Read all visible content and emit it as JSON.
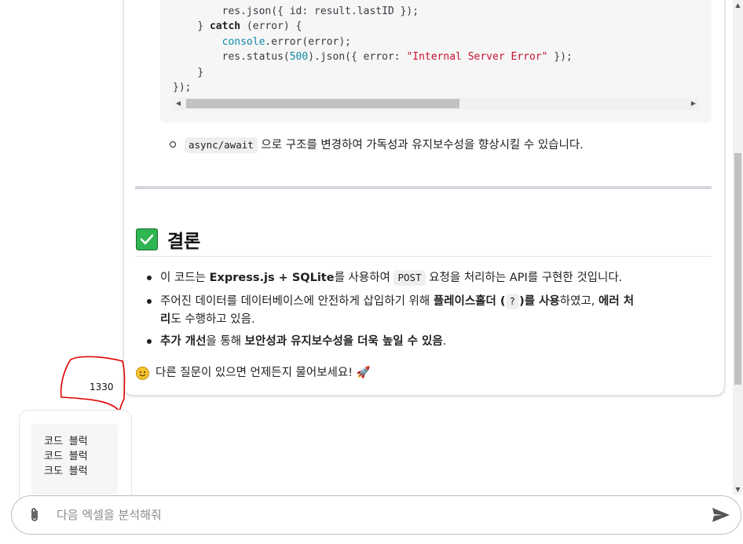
{
  "code": {
    "lines": [
      {
        "indent": "        ",
        "parts": [
          {
            "t": "res.json({ id: result.lastID });",
            "c": ""
          }
        ]
      },
      {
        "indent": "    ",
        "parts": [
          {
            "t": "} ",
            "c": ""
          },
          {
            "t": "catch",
            "c": "kw"
          },
          {
            "t": " (error) {",
            "c": ""
          }
        ]
      },
      {
        "indent": "        ",
        "parts": [
          {
            "t": "console",
            "c": "fn"
          },
          {
            "t": ".error(error);",
            "c": ""
          }
        ]
      },
      {
        "indent": "        ",
        "parts": [
          {
            "t": "res.status(",
            "c": ""
          },
          {
            "t": "500",
            "c": "num"
          },
          {
            "t": ").json({ error: ",
            "c": ""
          },
          {
            "t": "\"Internal Server Error\"",
            "c": "str"
          },
          {
            "t": " });",
            "c": ""
          }
        ]
      },
      {
        "indent": "    ",
        "parts": [
          {
            "t": "}",
            "c": ""
          }
        ]
      },
      {
        "indent": "",
        "parts": [
          {
            "t": "});",
            "c": ""
          }
        ]
      }
    ]
  },
  "subbullet": {
    "code": "async/await",
    "text": " 으로 구조를 변경하여 가독성과 유지보수성을 향상시킬 수 있습니다."
  },
  "conclusion": {
    "heading": "결론",
    "b1": {
      "p1": "이 코드는 ",
      "b1": "Express.js + SQLite",
      "p2": "를 사용하여 ",
      "code": "POST",
      "p3": " 요청을 처리하는 API를 구현한 것입니다."
    },
    "b2": {
      "p1": "주어진 데이터를 데이터베이스에 안전하게 삽입하기 위해 ",
      "b1": "플레이스홀더 (",
      "code": "?",
      "b2": ")를 사용",
      "p2": "하였고, ",
      "b3": "에러 처",
      "b4": "리",
      "p3": "도 수행하고 있음."
    },
    "b3": {
      "b1": "추가 개선",
      "p1": "을 통해 ",
      "b2": "보안성과 유지보수성을 더욱 높일 수 있음",
      "p2": "."
    },
    "closing": "다른 질문이 있으면 언제든지 물어보세요! 🚀"
  },
  "annotation": {
    "number": "1330",
    "color": "#e00000"
  },
  "user_message": {
    "lines": [
      "코드 블럭",
      "코드 블럭",
      "크도 블럭"
    ]
  },
  "input": {
    "placeholder": "다음 엑셀을 분석해줘",
    "value": ""
  },
  "icons": {
    "check": "check-box-icon",
    "smile": "smile-emoji-icon",
    "attach": "paperclip-icon",
    "send": "send-icon"
  },
  "colors": {
    "accent_green": "#2fb551",
    "annotation_red": "#e00000"
  }
}
